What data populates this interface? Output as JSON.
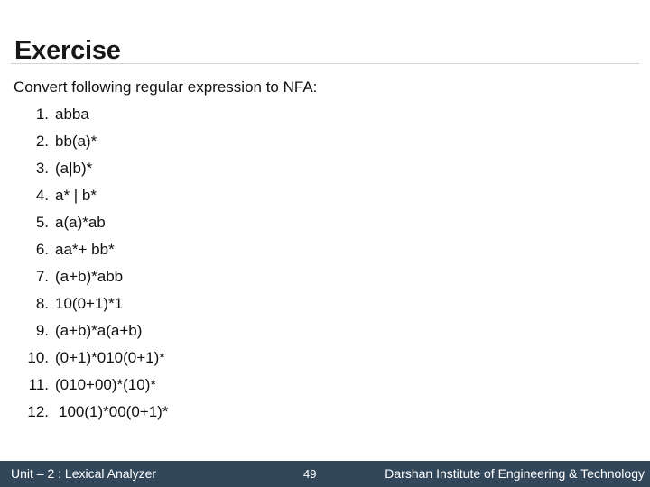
{
  "slide": {
    "title": "Exercise",
    "lead": "Convert following regular expression to NFA:",
    "items": [
      {
        "num": "1.",
        "expr": "abba"
      },
      {
        "num": "2.",
        "expr": "bb(a)*"
      },
      {
        "num": "3.",
        "expr": "(a|b)*"
      },
      {
        "num": "4.",
        "expr": "a* | b*"
      },
      {
        "num": "5.",
        "expr": "a(a)*ab"
      },
      {
        "num": "6.",
        "expr": "aa*+ bb*"
      },
      {
        "num": "7.",
        "expr": "(a+b)*abb"
      },
      {
        "num": "8.",
        "expr": "10(0+1)*1"
      },
      {
        "num": "9.",
        "expr": "(a+b)*a(a+b)"
      },
      {
        "num": "10.",
        "expr": "(0+1)*010(0+1)*"
      },
      {
        "num": "11.",
        "expr": "(010+00)*(10)*"
      },
      {
        "num": "12.",
        "expr": "100(1)*00(0+1)*"
      }
    ]
  },
  "footer": {
    "unit": "Unit – 2 : Lexical Analyzer",
    "page": "49",
    "institute": "Darshan Institute of Engineering & Technology"
  },
  "colors": {
    "footer_bg": "#33475b",
    "footer_text": "#ffffff",
    "title_text": "#171717",
    "body_text": "#111111",
    "rule": "#d4d4d4",
    "background": "#ffffff"
  }
}
